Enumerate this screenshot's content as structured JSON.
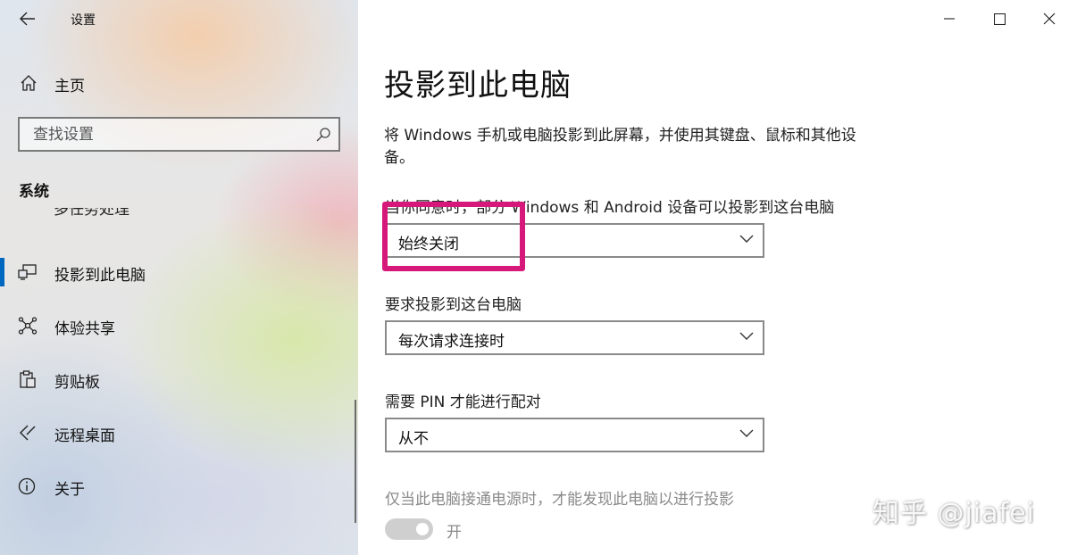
{
  "window": {
    "title": "设置",
    "controls": {
      "minimize": "minimize",
      "maximize": "maximize",
      "close": "close"
    }
  },
  "sidebar": {
    "home_label": "主页",
    "search_placeholder": "查找设置",
    "section_header": "系统",
    "partial_item_label": "多任务处理",
    "items": [
      {
        "label": "投影到此电脑",
        "icon": "project-icon",
        "active": true
      },
      {
        "label": "体验共享",
        "icon": "shared-experiences-icon",
        "active": false
      },
      {
        "label": "剪贴板",
        "icon": "clipboard-icon",
        "active": false
      },
      {
        "label": "远程桌面",
        "icon": "remote-desktop-icon",
        "active": false
      },
      {
        "label": "关于",
        "icon": "info-icon",
        "active": false
      }
    ]
  },
  "main": {
    "title": "投影到此电脑",
    "description": "将 Windows 手机或电脑投影到此屏幕，并使用其键盘、鼠标和其他设备。",
    "setting1": {
      "label": "当你同意时，部分 Windows 和 Android 设备可以投影到这台电脑",
      "value": "始终关闭"
    },
    "setting2": {
      "label": "要求投影到这台电脑",
      "value": "每次请求连接时"
    },
    "setting3": {
      "label": "需要 PIN 才能进行配对",
      "value": "从不"
    },
    "setting4": {
      "label": "仅当此电脑接通电源时，才能发现此电脑以进行投影",
      "toggle_label": "开",
      "enabled": false
    }
  },
  "annotation": {
    "color": "#d6187a"
  },
  "watermark": "知乎 @jiafei",
  "colors": {
    "accent": "#0067c0",
    "highlight": "#d6187a"
  }
}
